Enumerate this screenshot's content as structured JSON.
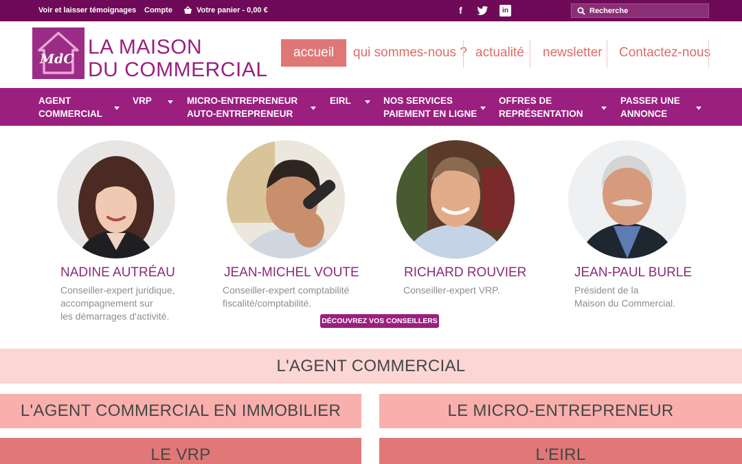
{
  "topbar": {
    "testimonials_link": "Voir et laisser témoignages",
    "account_link": "Compte",
    "cart_text": "Votre panier - 0,00 €",
    "search_placeholder": "Recherche",
    "social": [
      "facebook-icon",
      "twitter-icon",
      "linkedin-icon"
    ]
  },
  "header": {
    "logo_initials": "MdC",
    "logo_line1": "LA MAISON",
    "logo_line2": "DU COMMERCIAL",
    "nav": [
      "accueil",
      "qui sommes-nous ?",
      "actualité",
      "newsletter",
      "Contactez-nous"
    ]
  },
  "menu": [
    {
      "line1": "AGENT",
      "line2": "COMMERCIAL"
    },
    {
      "line1": "VRP",
      "line2": ""
    },
    {
      "line1": "MICRO-ENTREPRENEUR",
      "line2": "AUTO-ENTREPRENEUR"
    },
    {
      "line1": "EIRL",
      "line2": ""
    },
    {
      "line1": "NOS SERVICES",
      "line2": "PAIEMENT EN LIGNE"
    },
    {
      "line1": "OFFRES DE",
      "line2": "REPRÉSENTATION"
    },
    {
      "line1": "PASSER UNE",
      "line2": "ANNONCE"
    }
  ],
  "advisors": [
    {
      "name": "NADINE AUTRÉAU",
      "desc": "Conseiller-expert juridique,\naccompagnement sur\nles démarrages d'activité."
    },
    {
      "name": "JEAN-MICHEL VOUTE",
      "desc": "Conseiller-expert comptabilité\nfiscalité/comptabilité."
    },
    {
      "name": "RICHARD ROUVIER",
      "desc": "Conseiller-expert VRP."
    },
    {
      "name": "JEAN-PAUL BURLE",
      "desc": "Président de la\nMaison du Commercial."
    }
  ],
  "discover_button": "DÉCOUVREZ VOS CONSEILLERS",
  "categories": {
    "agent": "L'AGENT COMMERCIAL",
    "immobilier": "L'AGENT COMMERCIAL EN IMMOBILIER",
    "micro": "LE MICRO-ENTREPRENEUR",
    "vrp": "LE VRP",
    "eirl": "L'EIRL"
  },
  "colors": {
    "topbar": "#6e0a57",
    "menubar": "#9a1f7f",
    "accent_coral": "#e07777",
    "pink_light": "#fbd6d4",
    "pink_mid": "#f9b0ad",
    "pink_dark": "#e07878"
  }
}
